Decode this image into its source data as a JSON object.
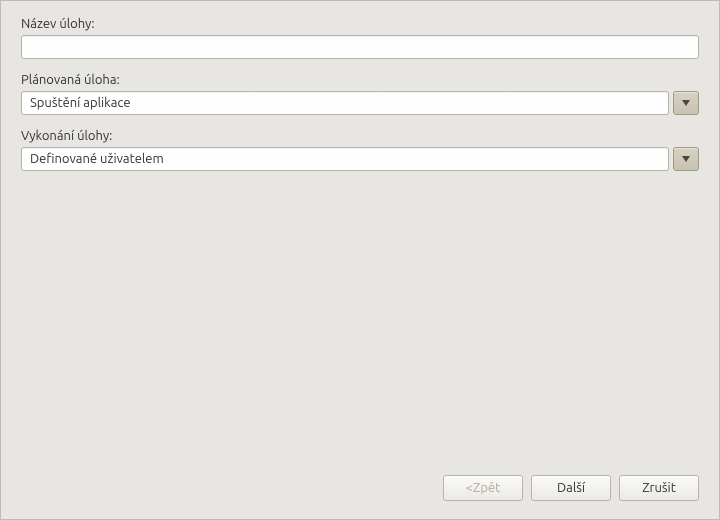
{
  "fields": {
    "task_name": {
      "label": "Název úlohy:",
      "value": ""
    },
    "planned_task": {
      "label": "Plánovaná úloha:",
      "value": "Spuštění aplikace"
    },
    "task_execution": {
      "label": "Vykonání úlohy:",
      "value": "Definované uživatelem"
    }
  },
  "buttons": {
    "back": "<Zpět",
    "next": "Další",
    "cancel": "Zrušit"
  }
}
